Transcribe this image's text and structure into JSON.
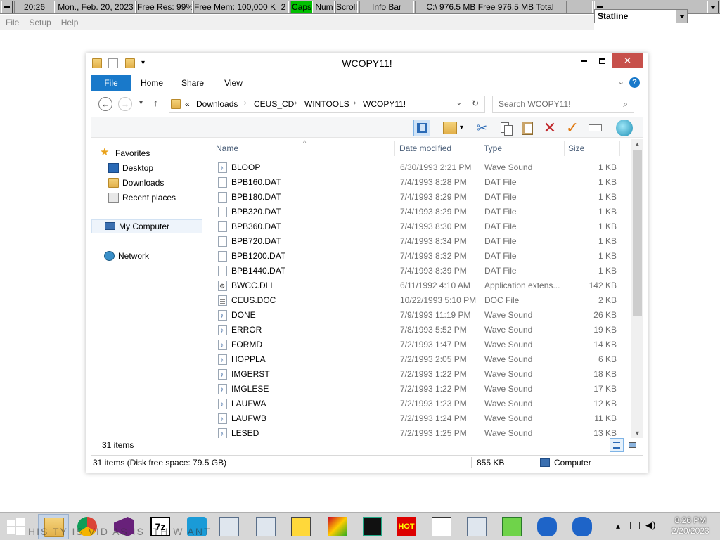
{
  "statusbar": {
    "time": "20:26",
    "date": "Mon., Feb. 20, 2023",
    "free_res": "Free Res: 99%",
    "free_mem": "Free Mem: 100,000 KB",
    "num_value": "2",
    "caps": "Caps",
    "num": "Num",
    "scroll": "Scroll",
    "info_bar": "Info Bar",
    "disk": "C:\\ 976.5 MB Free  976.5 MB Total",
    "dropdown_value": "Statline"
  },
  "app_menu": [
    "File",
    "Setup",
    "Help"
  ],
  "window": {
    "title": "WCOPY11!",
    "close_glyph": "✕",
    "tabs": {
      "file": "File",
      "home": "Home",
      "share": "Share",
      "view": "View"
    },
    "help": "?",
    "breadcrumb": {
      "prefix": "«",
      "items": [
        "Downloads",
        "CEUS_CD",
        "WINTOOLS",
        "WCOPY11!"
      ]
    },
    "search_placeholder": "Search WCOPY11!"
  },
  "navpane": {
    "favorites": "Favorites",
    "desktop": "Desktop",
    "downloads": "Downloads",
    "recent": "Recent places",
    "my_computer": "My Computer",
    "network": "Network"
  },
  "columns": {
    "name": "Name",
    "date": "Date modified",
    "type": "Type",
    "size": "Size"
  },
  "files": [
    {
      "name": "BLOOP",
      "date": "6/30/1993 2:21 PM",
      "type": "Wave Sound",
      "size": "1 KB",
      "icon": "wave"
    },
    {
      "name": "BPB160.DAT",
      "date": "7/4/1993 8:28 PM",
      "type": "DAT File",
      "size": "1 KB",
      "icon": "blank"
    },
    {
      "name": "BPB180.DAT",
      "date": "7/4/1993 8:29 PM",
      "type": "DAT File",
      "size": "1 KB",
      "icon": "blank"
    },
    {
      "name": "BPB320.DAT",
      "date": "7/4/1993 8:29 PM",
      "type": "DAT File",
      "size": "1 KB",
      "icon": "blank"
    },
    {
      "name": "BPB360.DAT",
      "date": "7/4/1993 8:30 PM",
      "type": "DAT File",
      "size": "1 KB",
      "icon": "blank"
    },
    {
      "name": "BPB720.DAT",
      "date": "7/4/1993 8:34 PM",
      "type": "DAT File",
      "size": "1 KB",
      "icon": "blank"
    },
    {
      "name": "BPB1200.DAT",
      "date": "7/4/1993 8:32 PM",
      "type": "DAT File",
      "size": "1 KB",
      "icon": "blank"
    },
    {
      "name": "BPB1440.DAT",
      "date": "7/4/1993 8:39 PM",
      "type": "DAT File",
      "size": "1 KB",
      "icon": "blank"
    },
    {
      "name": "BWCC.DLL",
      "date": "6/11/1992 4:10 AM",
      "type": "Application extens...",
      "size": "142 KB",
      "icon": "dll"
    },
    {
      "name": "CEUS.DOC",
      "date": "10/22/1993 5:10 PM",
      "type": "DOC File",
      "size": "2 KB",
      "icon": "doc"
    },
    {
      "name": "DONE",
      "date": "7/9/1993 11:19 PM",
      "type": "Wave Sound",
      "size": "26 KB",
      "icon": "wave"
    },
    {
      "name": "ERROR",
      "date": "7/8/1993 5:52 PM",
      "type": "Wave Sound",
      "size": "19 KB",
      "icon": "wave"
    },
    {
      "name": "FORMD",
      "date": "7/2/1993 1:47 PM",
      "type": "Wave Sound",
      "size": "14 KB",
      "icon": "wave"
    },
    {
      "name": "HOPPLA",
      "date": "7/2/1993 2:05 PM",
      "type": "Wave Sound",
      "size": "6 KB",
      "icon": "wave"
    },
    {
      "name": "IMGERST",
      "date": "7/2/1993 1:22 PM",
      "type": "Wave Sound",
      "size": "18 KB",
      "icon": "wave"
    },
    {
      "name": "IMGLESE",
      "date": "7/2/1993 1:22 PM",
      "type": "Wave Sound",
      "size": "17 KB",
      "icon": "wave"
    },
    {
      "name": "LAUFWA",
      "date": "7/2/1993 1:23 PM",
      "type": "Wave Sound",
      "size": "12 KB",
      "icon": "wave"
    },
    {
      "name": "LAUFWB",
      "date": "7/2/1993 1:24 PM",
      "type": "Wave Sound",
      "size": "11 KB",
      "icon": "wave"
    },
    {
      "name": "LESED",
      "date": "7/2/1993 1:25 PM",
      "type": "Wave Sound",
      "size": "13 KB",
      "icon": "wave"
    }
  ],
  "item_count": "31 items",
  "status": {
    "left": "31 items (Disk free space: 79.5 GB)",
    "size": "855 KB",
    "location": "Computer"
  },
  "taskbar": {
    "clock_time": "8:26 PM",
    "clock_date": "2/20/2023",
    "ghost_text": "HIS TY  IS   VID  AS IS  ITH   W  ANT"
  },
  "colors": {
    "accent": "#1979ca",
    "close": "#c7504b",
    "caps": "#00c000"
  }
}
